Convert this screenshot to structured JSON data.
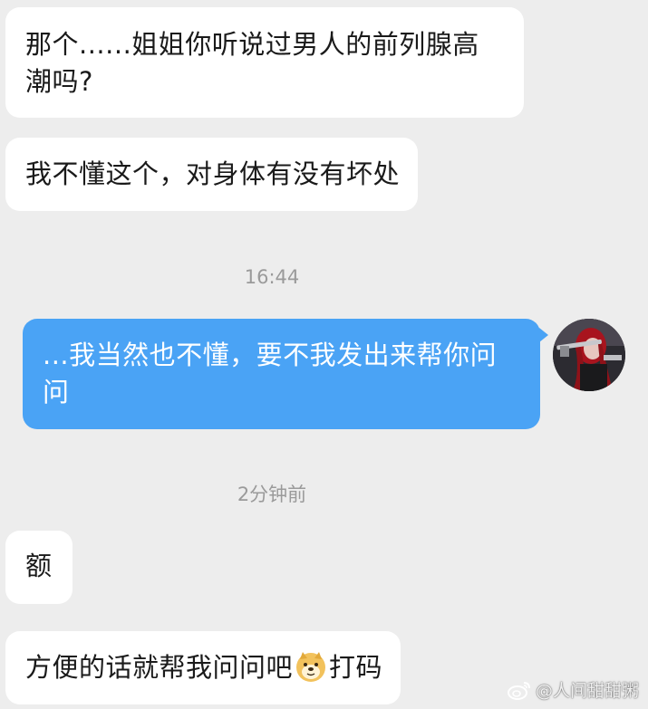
{
  "chat": {
    "messages": [
      {
        "sender": "other",
        "text": "那个......姐姐你听说过男人的前列腺高潮吗?"
      },
      {
        "sender": "other",
        "text": "我不懂这个，对身体有没有坏处"
      },
      {
        "sender": "self",
        "text": "...我当然也不懂，要不我发出来帮你问问"
      },
      {
        "sender": "other",
        "text": "额"
      },
      {
        "sender": "other",
        "text_before": "方便的话就帮我问问吧",
        "emoji": "doge-emoji",
        "text_after": "打码"
      }
    ],
    "timestamps": [
      "16:44",
      "2分钟前"
    ]
  },
  "watermark": {
    "text": "@人间甜甜粥",
    "icon": "weibo-icon"
  },
  "colors": {
    "background": "#ededed",
    "incoming_bubble": "#ffffff",
    "outgoing_bubble": "#4aa3f5",
    "timestamp": "#9a9a9a"
  }
}
